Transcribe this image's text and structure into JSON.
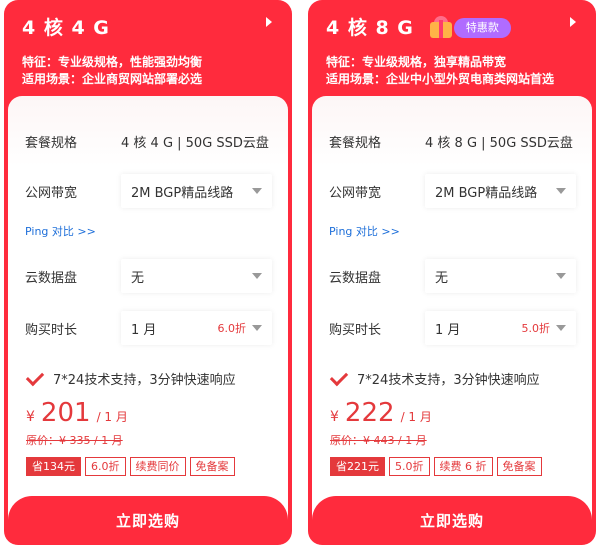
{
  "plans": [
    {
      "title": "4 核 4 G",
      "feature": "特征：专业级规格，性能强劲均衡",
      "scenario": "适用场景：企业商贸网站部署必选",
      "promo_label": "",
      "spec_label": "套餐规格",
      "spec_value": "4 核 4 G | 50G SSD云盘",
      "bandwidth_label": "公网带宽",
      "bandwidth_value": "2M BGP精品线路",
      "ping_link": "Ping 对比 >>",
      "disk_label": "云数据盘",
      "disk_value": "无",
      "duration_label": "购买时长",
      "duration_value": "1 月",
      "duration_discount": "6.0折",
      "support": "7*24技术支持，3分钟快速响应",
      "currency": "¥",
      "price": "201",
      "price_unit": "/ 1 月",
      "original_price": "原价：¥ 335 / 1 月",
      "tags": [
        "省134元",
        "6.0折",
        "续费同价",
        "免备案"
      ],
      "buy_label": "立即选购"
    },
    {
      "title": "4 核 8 G",
      "feature": "特征：专业级规格，独享精品带宽",
      "scenario": "适用场景：企业中小型外贸电商类网站首选",
      "promo_label": "特惠款",
      "spec_label": "套餐规格",
      "spec_value": "4 核 8 G | 50G SSD云盘",
      "bandwidth_label": "公网带宽",
      "bandwidth_value": "2M BGP精品线路",
      "ping_link": "Ping 对比 >>",
      "disk_label": "云数据盘",
      "disk_value": "无",
      "duration_label": "购买时长",
      "duration_value": "1 月",
      "duration_discount": "5.0折",
      "support": "7*24技术支持，3分钟快速响应",
      "currency": "¥",
      "price": "222",
      "price_unit": "/ 1 月",
      "original_price": "原价：¥ 443 / 1 月",
      "tags": [
        "省221元",
        "5.0折",
        "续费 6 折",
        "免备案"
      ],
      "buy_label": "立即选购"
    }
  ],
  "colors": {
    "brand_red": "#ff2b3d",
    "accent_red": "#e4393c",
    "link_blue": "#1e6fd9",
    "promo_purple": "#b06cff"
  },
  "icons": {
    "title_arrow": "caret-right-icon",
    "select_caret": "caret-down-icon",
    "support_check": "check-icon",
    "promo_gift": "gift-icon"
  }
}
